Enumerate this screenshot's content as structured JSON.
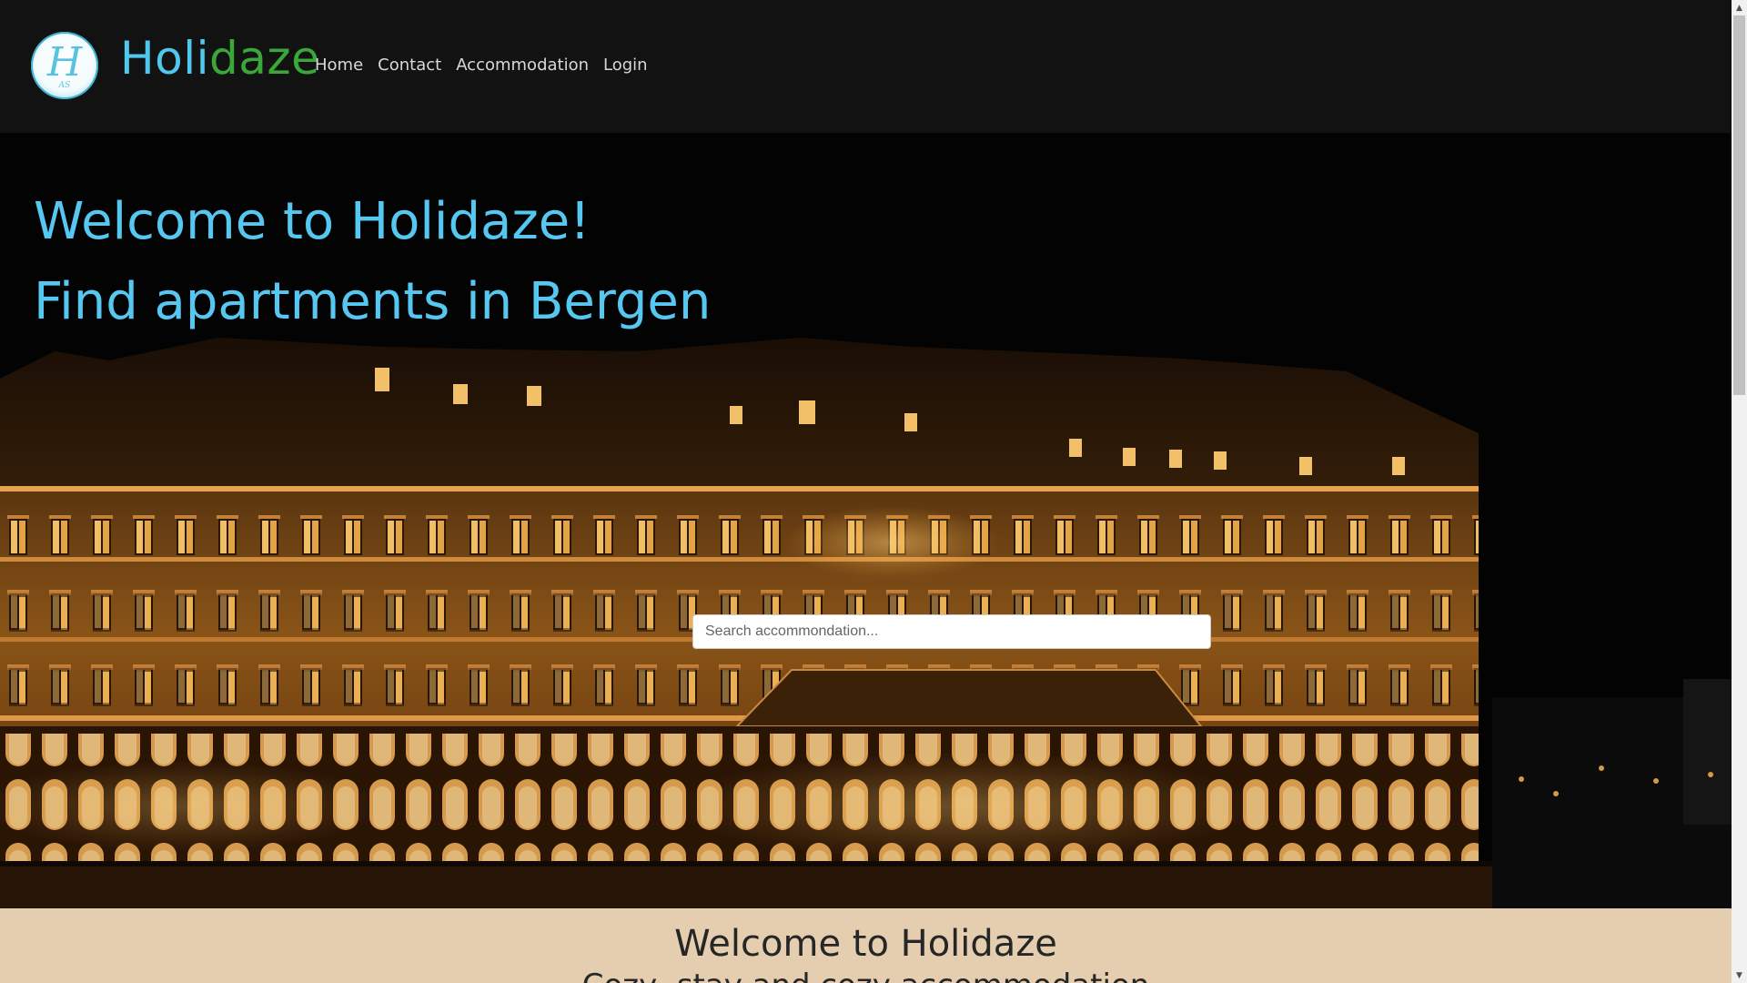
{
  "brand": {
    "logo_letter": "H",
    "logo_sub": "AS",
    "name_part1": "Holi",
    "name_part2": "daze",
    "color_part1": "#4fc8f0",
    "color_part2": "#3aa838"
  },
  "nav": {
    "items": [
      {
        "label": "Home"
      },
      {
        "label": "Contact"
      },
      {
        "label": "Accommodation"
      },
      {
        "label": "Login"
      }
    ]
  },
  "hero": {
    "title_line1": "Welcome to Holidaze!",
    "title_line2": "Find apartments in Bergen",
    "title_color": "#56c7f1",
    "search": {
      "placeholder": "Search accommondation...",
      "value": ""
    }
  },
  "intro": {
    "heading": "Welcome to Holidaze",
    "subheading": "Cozy, stay and cozy accommodation",
    "background": "#e4ceaf"
  },
  "icons": {
    "scroll_up": "triangle-up",
    "scroll_down": "triangle-down"
  }
}
